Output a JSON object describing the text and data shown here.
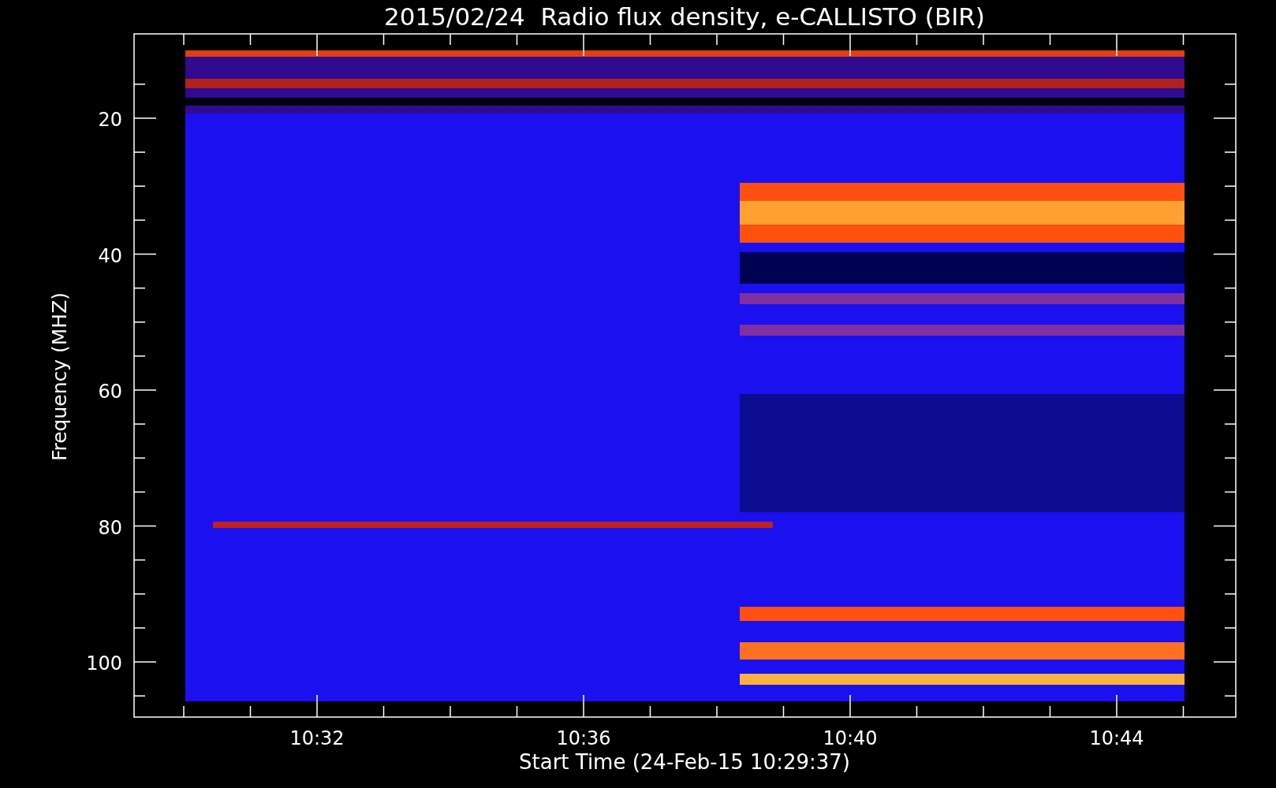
{
  "chart": {
    "title": "2015/02/24  Radio flux density, e-CALLISTO (BIR)",
    "ylabel": "Frequency (MHZ)",
    "yticks": [
      "20",
      "40",
      "60",
      "80",
      "100"
    ],
    "xticks": [
      "10:32",
      "10:36",
      "10:40",
      "10:44"
    ],
    "xlabel": "Start Time (24-Feb-15 10:29:37)"
  }
}
